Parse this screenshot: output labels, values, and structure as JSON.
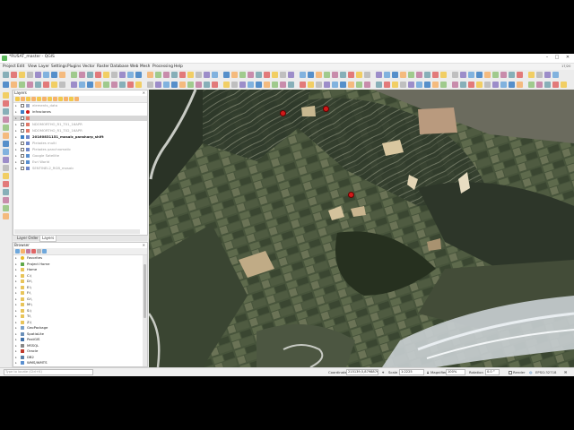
{
  "window": {
    "title": "*RUSAT_master - QGIS",
    "controls": [
      "–",
      "□",
      "✕"
    ]
  },
  "menus": [
    "Project",
    "Edit",
    "View",
    "Layer",
    "Settings",
    "Plugins",
    "Vector",
    "Raster",
    "Database",
    "Web",
    "Mesh",
    "Processing",
    "Help"
  ],
  "toolbar_hint": "17/20",
  "layers_panel": {
    "title": "Layers",
    "items": [
      {
        "label": "elements_data",
        "checked": false,
        "icon": "vector-polygon-icon",
        "icon_color": "#9aa8c8"
      },
      {
        "label": "infraciones",
        "checked": true,
        "icon": "point-symbol-icon",
        "icon_color": "#d11a1a"
      },
      {
        "label": "",
        "checked": false,
        "icon": "raster-icon",
        "icon_color": "#e07b6b",
        "selected": true
      },
      {
        "label": "NDOMORTHO_R1_T01_16APR",
        "checked": false,
        "icon": "raster-icon",
        "icon_color": "#e07b6b"
      },
      {
        "label": "NDOMORTHO_R1_T02_16APR",
        "checked": false,
        "icon": "raster-icon",
        "icon_color": "#e07b6b"
      },
      {
        "label": "20160831151_mosaic_pansharp_shift",
        "checked": true,
        "icon": "raster-icon",
        "icon_color": "#6f87c9",
        "bold": true
      },
      {
        "label": "Pleiades multi",
        "checked": false,
        "icon": "raster-icon",
        "icon_color": "#6f87c9"
      },
      {
        "label": "Pleiades panchromatic",
        "checked": false,
        "icon": "raster-icon",
        "icon_color": "#6f87c9"
      },
      {
        "label": "Google Satellite",
        "checked": false,
        "icon": "web-layer-icon",
        "icon_color": "#5a8fcf"
      },
      {
        "label": "Esri World",
        "checked": false,
        "icon": "web-layer-icon",
        "icon_color": "#5a8fcf"
      },
      {
        "label": "SENTINEL2_RGB_mosaic",
        "checked": false,
        "icon": "raster-icon",
        "icon_color": "#6f87c9"
      }
    ]
  },
  "tabs": {
    "layer_order": "Layer Order",
    "layers": "Layers"
  },
  "browser_panel": {
    "title": "Browser",
    "items": [
      {
        "label": "Favorites",
        "icon": "star-icon",
        "color": "#e8b923"
      },
      {
        "label": "Project Home",
        "icon": "folder-icon",
        "color": "#5fa84a"
      },
      {
        "label": "Home",
        "icon": "folder-icon",
        "color": "#e8c45a"
      },
      {
        "label": "C:\\",
        "icon": "drive-icon",
        "color": "#e8c45a"
      },
      {
        "label": "D:\\",
        "icon": "drive-icon",
        "color": "#e8c45a"
      },
      {
        "label": "E:\\",
        "icon": "drive-icon",
        "color": "#e8c45a"
      },
      {
        "label": "F:\\",
        "icon": "drive-icon",
        "color": "#e8c45a"
      },
      {
        "label": "G:\\",
        "icon": "drive-icon",
        "color": "#e8c45a"
      },
      {
        "label": "M:\\",
        "icon": "drive-icon",
        "color": "#e8c45a"
      },
      {
        "label": "S:\\",
        "icon": "drive-icon",
        "color": "#e8c45a"
      },
      {
        "label": "T:\\",
        "icon": "drive-icon",
        "color": "#e8c45a"
      },
      {
        "label": "Z:\\",
        "icon": "drive-icon",
        "color": "#e8c45a"
      },
      {
        "label": "GeoPackage",
        "icon": "geopackage-icon",
        "color": "#7aa0c8"
      },
      {
        "label": "SpatiaLite",
        "icon": "spatialite-icon",
        "color": "#6a8fb8"
      },
      {
        "label": "PostGIS",
        "icon": "postgis-icon",
        "color": "#3f6fa8"
      },
      {
        "label": "MSSQL",
        "icon": "mssql-icon",
        "color": "#888888"
      },
      {
        "label": "Oracle",
        "icon": "oracle-icon",
        "color": "#c0392b"
      },
      {
        "label": "DB2",
        "icon": "db2-icon",
        "color": "#5a7fa8"
      },
      {
        "label": "WMS/WMTS",
        "icon": "wms-icon",
        "color": "#5a8fcf"
      }
    ]
  },
  "locator": {
    "placeholder": "Type to locate (Ctrl+K)"
  },
  "status": {
    "coordinate_label": "Coordinate",
    "coordinate_value": "215139,5,8798876,5",
    "scale_label": "Scale",
    "scale_value": "1:2225",
    "magnifier_label": "Magnifier",
    "magnifier_value": "100%",
    "rotation_label": "Rotation",
    "rotation_value": "0.0 °",
    "render_label": "Render",
    "crs": "EPSG:32718"
  },
  "colors": {
    "accent": "#3c7fc4",
    "marker": "#d11a1a"
  }
}
